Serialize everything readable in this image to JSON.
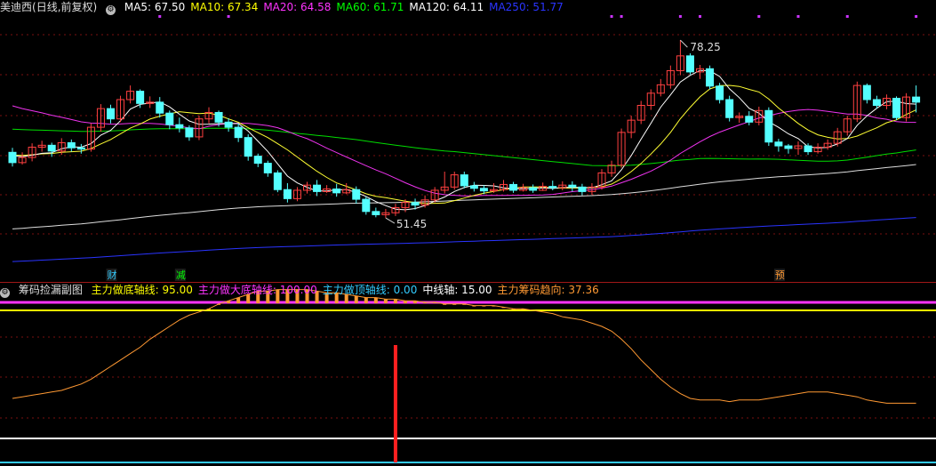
{
  "main_header": {
    "stock_name": "美迪西",
    "period_label": "(日线,前复权)",
    "indicators": [
      {
        "label": "MA5: 67.50",
        "color": "#ffffff"
      },
      {
        "label": "MA10: 67.34",
        "color": "#ffff00"
      },
      {
        "label": "MA20: 64.58",
        "color": "#ff33ff"
      },
      {
        "label": "MA60: 61.71",
        "color": "#00ff00"
      },
      {
        "label": "MA120: 64.11",
        "color": "#ffffff"
      },
      {
        "label": "MA250: 51.77",
        "color": "#2a34ff"
      }
    ]
  },
  "sub_header": {
    "title": "筹码捡漏副图",
    "indicators": [
      {
        "label": "主力做底轴线: 95.00",
        "color": "#ffff00"
      },
      {
        "label": "主力做大底轴线: 100.00",
        "color": "#ff33ff"
      },
      {
        "label": "主力做顶轴线: 0.00",
        "color": "#33ccff"
      },
      {
        "label": "中线轴: 15.00",
        "color": "#ffffff"
      },
      {
        "label": "主力筹码趋向: 37.36",
        "color": "#ff9933"
      }
    ]
  },
  "markers": [
    {
      "text": "财",
      "color": "#33ccff"
    },
    {
      "text": "减",
      "color": "#00ff00"
    },
    {
      "text": "预",
      "color": "#ff9933"
    }
  ],
  "price_annotations": {
    "high": "78.25",
    "low": "51.45"
  },
  "colors": {
    "up": "#ff4040",
    "down": "#54ffff",
    "grid": "#7a1010",
    "background": "#000000"
  },
  "chart_data": [
    {
      "type": "candlestick",
      "title": "美迪西 (日线,前复权)",
      "ylim": [
        43,
        82
      ],
      "n_days": 93,
      "candles": [
        [
          60.8,
          59.2,
          61.5,
          58.6
        ],
        [
          59.2,
          60.0,
          60.8,
          58.9
        ],
        [
          60.0,
          61.6,
          62.2,
          59.4
        ],
        [
          61.6,
          61.9,
          62.6,
          60.9
        ],
        [
          61.9,
          61.0,
          62.3,
          60.1
        ],
        [
          61.0,
          62.3,
          63.0,
          60.4
        ],
        [
          62.3,
          61.5,
          62.8,
          60.9
        ],
        [
          61.5,
          61.3,
          62.1,
          60.6
        ],
        [
          61.3,
          64.7,
          65.3,
          60.9
        ],
        [
          64.7,
          67.6,
          68.3,
          64.0
        ],
        [
          67.6,
          66.0,
          68.2,
          65.3
        ],
        [
          66.0,
          69.0,
          69.6,
          65.5
        ],
        [
          69.0,
          70.3,
          71.2,
          68.4
        ],
        [
          70.3,
          68.4,
          70.6,
          67.7
        ],
        [
          68.4,
          68.6,
          69.5,
          67.7
        ],
        [
          68.6,
          66.9,
          69.4,
          66.2
        ],
        [
          66.9,
          65.1,
          67.3,
          64.4
        ],
        [
          65.1,
          64.6,
          66.2,
          63.9
        ],
        [
          64.6,
          63.2,
          65.0,
          62.6
        ],
        [
          63.2,
          66.0,
          66.5,
          62.7
        ],
        [
          66.0,
          67.0,
          67.8,
          65.3
        ],
        [
          67.0,
          65.5,
          67.3,
          64.8
        ],
        [
          65.5,
          64.7,
          66.1,
          64.0
        ],
        [
          64.7,
          63.1,
          65.3,
          62.4
        ],
        [
          63.1,
          60.2,
          63.6,
          59.5
        ],
        [
          60.2,
          59.1,
          60.6,
          58.5
        ],
        [
          59.1,
          57.6,
          59.5,
          57.0
        ],
        [
          57.6,
          55.0,
          58.0,
          54.6
        ],
        [
          55.0,
          53.6,
          56.0,
          53.0
        ],
        [
          53.6,
          54.9,
          55.4,
          53.2
        ],
        [
          54.9,
          55.7,
          56.2,
          54.4
        ],
        [
          55.7,
          54.7,
          56.5,
          54.0
        ],
        [
          54.7,
          55.1,
          55.7,
          54.5
        ],
        [
          55.1,
          54.5,
          55.9,
          53.9
        ],
        [
          54.5,
          55.0,
          56.0,
          54.3
        ],
        [
          55.0,
          53.5,
          55.5,
          52.8
        ],
        [
          53.5,
          51.6,
          53.9,
          51.1
        ],
        [
          51.6,
          51.1,
          52.2,
          50.7
        ],
        [
          51.1,
          51.4,
          52.0,
          50.6
        ],
        [
          51.4,
          52.2,
          52.8,
          50.9
        ],
        [
          52.2,
          53.0,
          53.5,
          51.5
        ],
        [
          53.0,
          52.6,
          53.6,
          51.9
        ],
        [
          52.6,
          53.4,
          54.1,
          52.2
        ],
        [
          53.4,
          54.9,
          55.4,
          53.0
        ],
        [
          54.9,
          55.4,
          57.8,
          54.4
        ],
        [
          55.4,
          57.3,
          57.8,
          55.0
        ],
        [
          57.3,
          55.6,
          57.8,
          55.2
        ],
        [
          55.6,
          55.2,
          56.2,
          54.7
        ],
        [
          55.2,
          54.8,
          55.7,
          54.3
        ],
        [
          54.8,
          55.0,
          56.0,
          54.5
        ],
        [
          55.0,
          55.8,
          56.5,
          54.7
        ],
        [
          55.8,
          54.9,
          56.2,
          54.5
        ],
        [
          54.9,
          55.3,
          55.9,
          54.7
        ],
        [
          55.3,
          54.9,
          55.8,
          54.5
        ],
        [
          54.9,
          55.5,
          56.1,
          54.8
        ],
        [
          55.5,
          55.3,
          56.4,
          54.9
        ],
        [
          55.3,
          55.7,
          56.3,
          54.9
        ],
        [
          55.7,
          55.4,
          56.3,
          54.7
        ],
        [
          55.4,
          54.7,
          55.9,
          54.1
        ],
        [
          54.7,
          55.4,
          56.0,
          54.2
        ],
        [
          55.4,
          57.6,
          58.2,
          55.0
        ],
        [
          57.6,
          58.8,
          59.5,
          57.0
        ],
        [
          58.8,
          63.9,
          64.5,
          58.4
        ],
        [
          63.9,
          65.8,
          66.5,
          63.0
        ],
        [
          65.8,
          68.1,
          68.8,
          65.2
        ],
        [
          68.1,
          70.0,
          70.6,
          67.4
        ],
        [
          70.0,
          71.3,
          72.2,
          69.5
        ],
        [
          71.3,
          73.5,
          74.3,
          70.7
        ],
        [
          73.5,
          75.8,
          78.25,
          72.8
        ],
        [
          75.8,
          73.3,
          76.2,
          72.9
        ],
        [
          73.3,
          73.8,
          74.4,
          72.2
        ],
        [
          73.8,
          71.1,
          74.3,
          70.6
        ],
        [
          71.1,
          69.0,
          71.6,
          68.4
        ],
        [
          69.0,
          66.2,
          69.6,
          65.6
        ],
        [
          66.2,
          66.4,
          67.0,
          65.4
        ],
        [
          66.4,
          65.5,
          67.2,
          65.0
        ],
        [
          65.5,
          67.3,
          67.9,
          65.0
        ],
        [
          67.3,
          62.4,
          67.8,
          61.8
        ],
        [
          62.4,
          61.8,
          62.9,
          60.9
        ],
        [
          61.8,
          61.4,
          62.1,
          60.6
        ],
        [
          61.4,
          61.8,
          62.5,
          60.4
        ],
        [
          61.8,
          60.9,
          62.2,
          60.4
        ],
        [
          60.9,
          61.6,
          62.2,
          60.6
        ],
        [
          61.6,
          62.2,
          62.8,
          61.2
        ],
        [
          62.2,
          64.0,
          64.6,
          61.7
        ],
        [
          64.0,
          66.0,
          66.5,
          63.4
        ],
        [
          66.0,
          71.2,
          71.8,
          65.5
        ],
        [
          71.2,
          69.0,
          71.5,
          68.4
        ],
        [
          69.0,
          68.1,
          69.6,
          67.6
        ],
        [
          68.1,
          69.2,
          69.8,
          67.5
        ],
        [
          69.2,
          66.2,
          69.5,
          65.8
        ],
        [
          66.2,
          69.4,
          70.0,
          65.6
        ],
        [
          69.4,
          68.6,
          71.2,
          67.0
        ]
      ]
    },
    {
      "type": "line",
      "title": "筹码捡漏副图",
      "ylim": [
        0,
        100
      ],
      "series": [
        {
          "name": "主力做底轴线",
          "constant": 95.0,
          "color": "#ffff00"
        },
        {
          "name": "主力做大底轴线",
          "constant": 100.0,
          "color": "#ff33ff"
        },
        {
          "name": "主力做顶轴线",
          "constant": 0.0,
          "color": "#33ccff"
        },
        {
          "name": "中线轴",
          "constant": 15.0,
          "color": "#ffffff"
        },
        {
          "name": "主力筹码趋向",
          "color": "#ff9933",
          "values": [
            40,
            41,
            42,
            43,
            44,
            45,
            47,
            49,
            52,
            56,
            60,
            64,
            68,
            72,
            77,
            81,
            85,
            89,
            92,
            94,
            96,
            99,
            101,
            103,
            105,
            107,
            107,
            108,
            108,
            108,
            108,
            107,
            106,
            106,
            105,
            104,
            103,
            103,
            102,
            102,
            101,
            101,
            100,
            100,
            99,
            99,
            99,
            98,
            98,
            98,
            97,
            96,
            96,
            95,
            94,
            93,
            91,
            90,
            89,
            87,
            85,
            82,
            77,
            71,
            64,
            58,
            52,
            47,
            43,
            40,
            39,
            39,
            39,
            38,
            39,
            39,
            39,
            40,
            41,
            42,
            43,
            44,
            44,
            44,
            43,
            42,
            41,
            39,
            38,
            37,
            37,
            37,
            37
          ]
        }
      ],
      "signal_day": 39,
      "signal_color": "#ff2020"
    }
  ]
}
